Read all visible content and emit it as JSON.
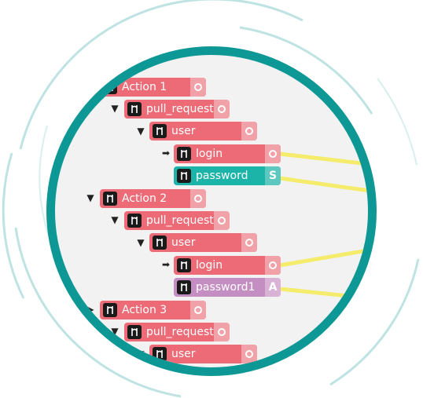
{
  "tree": {
    "actions": [
      {
        "label": "Action 1",
        "pull_request": "pull_request",
        "user": "user",
        "login": "login",
        "field": {
          "label": "password",
          "type": "S",
          "color": "#1cb3a8"
        }
      },
      {
        "label": "Action 2",
        "pull_request": "pull_request",
        "user": "user",
        "login": "login",
        "field": {
          "label": "password1",
          "type": "A",
          "color": "#c58ec2"
        }
      },
      {
        "label": "Action 3",
        "pull_request": "pull_request",
        "user": "user"
      }
    ]
  },
  "colors": {
    "ring": "#0e9895",
    "node": "#ec6b76",
    "wire": "#f4ec6a"
  }
}
